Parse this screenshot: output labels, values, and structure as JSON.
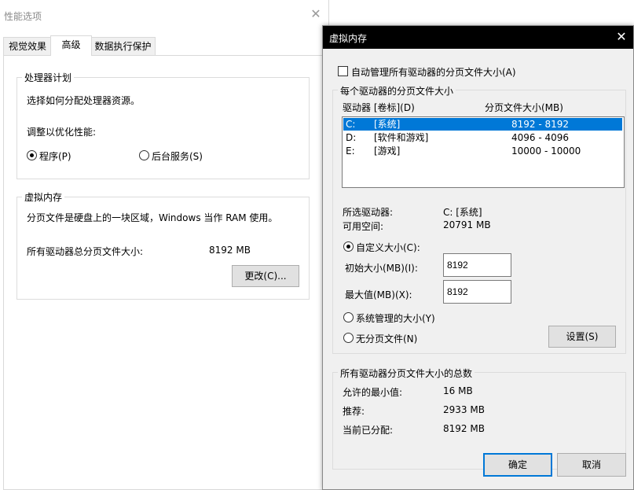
{
  "perf_window": {
    "title": "性能选项",
    "tabs": [
      {
        "label": "视觉效果"
      },
      {
        "label": "高级"
      },
      {
        "label": "数据执行保护"
      }
    ],
    "processor_group": {
      "title": "处理器计划",
      "description": "选择如何分配处理器资源。",
      "adjust_label": "调整以优化性能:",
      "options": [
        {
          "label": "程序(P)",
          "selected": true
        },
        {
          "label": "后台服务(S)",
          "selected": false
        }
      ]
    },
    "vm_group": {
      "title": "虚拟内存",
      "description": "分页文件是硬盘上的一块区域，Windows 当作 RAM 使用。",
      "total_label": "所有驱动器总分页文件大小:",
      "total_value": "8192 MB",
      "change_button": "更改(C)..."
    }
  },
  "vm_dialog": {
    "title": "虚拟内存",
    "auto_manage_label": "自动管理所有驱动器的分页文件大小(A)",
    "auto_manage_checked": false,
    "drive_group_title": "每个驱动器的分页文件大小",
    "columns": {
      "drive": "驱动器 [卷标](D)",
      "size": "分页文件大小(MB)"
    },
    "drives": [
      {
        "letter": "C:",
        "label": "[系统]",
        "size": "8192 - 8192",
        "selected": true
      },
      {
        "letter": "D:",
        "label": "[软件和游戏]",
        "size": "4096 - 4096",
        "selected": false
      },
      {
        "letter": "E:",
        "label": "[游戏]",
        "size": "10000 - 10000",
        "selected": false
      }
    ],
    "selected_drive_label": "所选驱动器:",
    "selected_drive_value": "C:  [系统]",
    "free_space_label": "可用空间:",
    "free_space_value": "20791 MB",
    "custom_size_label": "自定义大小(C):",
    "initial_size_label": "初始大小(MB)(I):",
    "initial_size_value": "8192",
    "max_size_label": "最大值(MB)(X):",
    "max_size_value": "8192",
    "system_managed_label": "系统管理的大小(Y)",
    "no_paging_label": "无分页文件(N)",
    "set_button": "设置(S)",
    "totals_group_title": "所有驱动器分页文件大小的总数",
    "min_allowed_label": "允许的最小值:",
    "min_allowed_value": "16 MB",
    "recommended_label": "推荐:",
    "recommended_value": "2933 MB",
    "current_label": "当前已分配:",
    "current_value": "8192 MB",
    "ok_button": "确定",
    "cancel_button": "取消"
  }
}
